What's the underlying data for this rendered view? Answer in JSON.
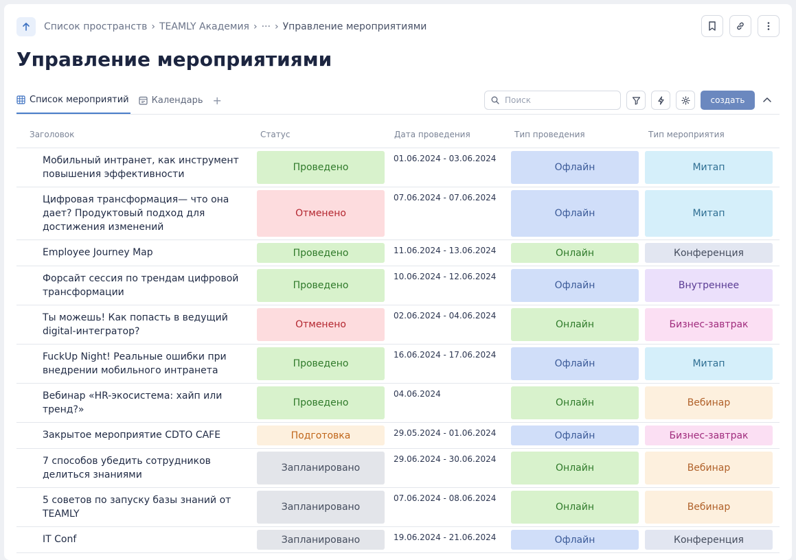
{
  "breadcrumb": [
    "Список пространств",
    "TEAMLY Академия",
    "···",
    "Управление мероприятиями"
  ],
  "page_title": "Управление мероприятиями",
  "tabs": [
    {
      "label": "Список мероприятий",
      "icon": "table-icon"
    },
    {
      "label": "Календарь",
      "icon": "calendar-icon"
    }
  ],
  "add_tab": "+",
  "search": {
    "placeholder": "Поиск",
    "value": ""
  },
  "create_label": "создать",
  "columns": [
    "Заголовок",
    "Статус",
    "Дата проведения",
    "Тип проведения",
    "Тип мероприятия"
  ],
  "colors": {
    "Проведено": {
      "bg": "#d8f2cc",
      "fg": "#2f7a2a"
    },
    "Отменено": {
      "bg": "#fddcde",
      "fg": "#b3262f"
    },
    "Подготовка": {
      "bg": "#fdf0de",
      "fg": "#c0661a"
    },
    "Запланировано": {
      "bg": "#e3e5ea",
      "fg": "#454d5e"
    },
    "Офлайн": {
      "bg": "#d0def9",
      "fg": "#3b5a98"
    },
    "Онлайн": {
      "bg": "#d8f2cc",
      "fg": "#2f7a2a"
    },
    "Митап": {
      "bg": "#d5effa",
      "fg": "#2f6f93"
    },
    "Конференция": {
      "bg": "#e2e6f1",
      "fg": "#454d5e"
    },
    "Внутреннее": {
      "bg": "#ebe0fb",
      "fg": "#5a3c94"
    },
    "Бизнес-завтрак": {
      "bg": "#fbdff3",
      "fg": "#a02c7d"
    },
    "Вебинар": {
      "bg": "#fdf0de",
      "fg": "#b0612a"
    }
  },
  "rows": [
    {
      "title": "Мобильный интранет, как инструмент повышения эффективности",
      "status": "Проведено",
      "date": "01.06.2024 - 03.06.2024",
      "mode": "Офлайн",
      "type": "Митап"
    },
    {
      "title": "Цифровая трансформация— что она дает? Продуктовый подход для достижения изменений",
      "status": "Отменено",
      "date": "07.06.2024 - 07.06.2024",
      "mode": "Офлайн",
      "type": "Митап"
    },
    {
      "title": "Employee Journey Map",
      "status": "Проведено",
      "date": "11.06.2024 - 13.06.2024",
      "mode": "Онлайн",
      "type": "Конференция"
    },
    {
      "title": "Форсайт сессия по трендам цифровой трансформации",
      "status": "Проведено",
      "date": "10.06.2024 - 12.06.2024",
      "mode": "Офлайн",
      "type": "Внутреннее"
    },
    {
      "title": "Ты можешь! Как попасть в ведущий digital-интегратор?",
      "status": "Отменено",
      "date": "02.06.2024 - 04.06.2024",
      "mode": "Онлайн",
      "type": "Бизнес-завтрак"
    },
    {
      "title": "FuckUp Night! Реальные ошибки при внедрении мобильного интранета",
      "status": "Проведено",
      "date": "16.06.2024 - 17.06.2024",
      "mode": "Офлайн",
      "type": "Митап"
    },
    {
      "title": "Вебинар «HR-экосистема: хайп или тренд?»",
      "status": "Проведено",
      "date": "04.06.2024",
      "mode": "Онлайн",
      "type": "Вебинар"
    },
    {
      "title": "Закрытое мероприятие CDTO CAFE",
      "status": "Подготовка",
      "date": "29.05.2024 - 01.06.2024",
      "mode": "Офлайн",
      "type": "Бизнес-завтрак"
    },
    {
      "title": "7 способов убедить сотрудников делиться знаниями",
      "status": "Запланировано",
      "date": "29.06.2024 - 30.06.2024",
      "mode": "Онлайн",
      "type": "Вебинар"
    },
    {
      "title": "5 советов по запуску базы знаний от TEAMLY",
      "status": "Запланировано",
      "date": "07.06.2024 - 08.06.2024",
      "mode": "Онлайн",
      "type": "Вебинар"
    },
    {
      "title": "IT Conf",
      "status": "Запланировано",
      "date": "19.06.2024 - 21.06.2024",
      "mode": "Офлайн",
      "type": "Конференция"
    }
  ]
}
